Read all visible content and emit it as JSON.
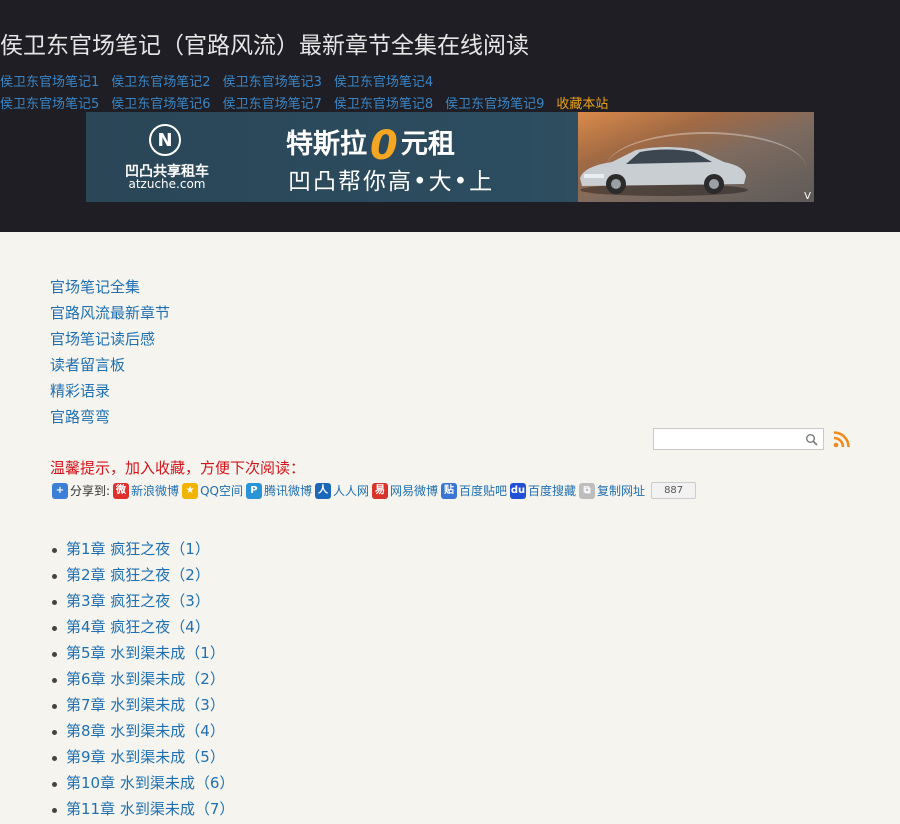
{
  "header": {
    "title": "侯卫东官场笔记（官路风流）最新章节全集在线阅读",
    "nav_row1": [
      "侯卫东官场笔记1",
      "侯卫东官场笔记2",
      "侯卫东官场笔记3",
      "侯卫东官场笔记4"
    ],
    "nav_row2": [
      "侯卫东官场笔记5",
      "侯卫东官场笔记6",
      "侯卫东官场笔记7",
      "侯卫东官场笔记8",
      "侯卫东官场笔记9"
    ],
    "favorite_label": "收藏本站"
  },
  "banner": {
    "logo_glyph": "N",
    "brand": "凹凸共享租车",
    "domain": "atzuche.com",
    "line1_prefix": "特斯拉",
    "line1_zero": "0",
    "line1_suffix": "元租",
    "line2": "凹凸帮你高•大•上",
    "corner_mark": "V",
    "accent": "#f5a623"
  },
  "side_links": [
    "官场笔记全集",
    "官路风流最新章节",
    "官场笔记读后感",
    "读者留言板",
    "精彩语录",
    "官路弯弯"
  ],
  "search": {
    "placeholder": "",
    "icon": "search-icon",
    "rss_icon": "rss-icon"
  },
  "tip": "温馨提示，加入收藏，方便下次阅读：",
  "share": {
    "label": "分享到:",
    "items": [
      {
        "name": "sina",
        "label": "新浪微博",
        "color": "#e0302c"
      },
      {
        "name": "qzone",
        "label": "QQ空间",
        "color": "#f0b400"
      },
      {
        "name": "tqq",
        "label": "腾讯微博",
        "color": "#2a95d6"
      },
      {
        "name": "renren",
        "label": "人人网",
        "color": "#1d67b8"
      },
      {
        "name": "netease",
        "label": "网易微博",
        "color": "#d8332c"
      },
      {
        "name": "tieba",
        "label": "百度贴吧",
        "color": "#3b75d3"
      },
      {
        "name": "baidu",
        "label": "百度搜藏",
        "color": "#2150d6"
      },
      {
        "name": "copy",
        "label": "复制网址",
        "color": "#bdbdbd"
      }
    ],
    "count": "887"
  },
  "chapters": [
    "第1章 疯狂之夜（1）",
    "第2章 疯狂之夜（2）",
    "第3章 疯狂之夜（3）",
    "第4章 疯狂之夜（4）",
    "第5章 水到渠未成（1）",
    "第6章 水到渠未成（2）",
    "第7章 水到渠未成（3）",
    "第8章 水到渠未成（4）",
    "第9章 水到渠未成（5）",
    "第10章 水到渠未成（6）",
    "第11章 水到渠未成（7）"
  ]
}
